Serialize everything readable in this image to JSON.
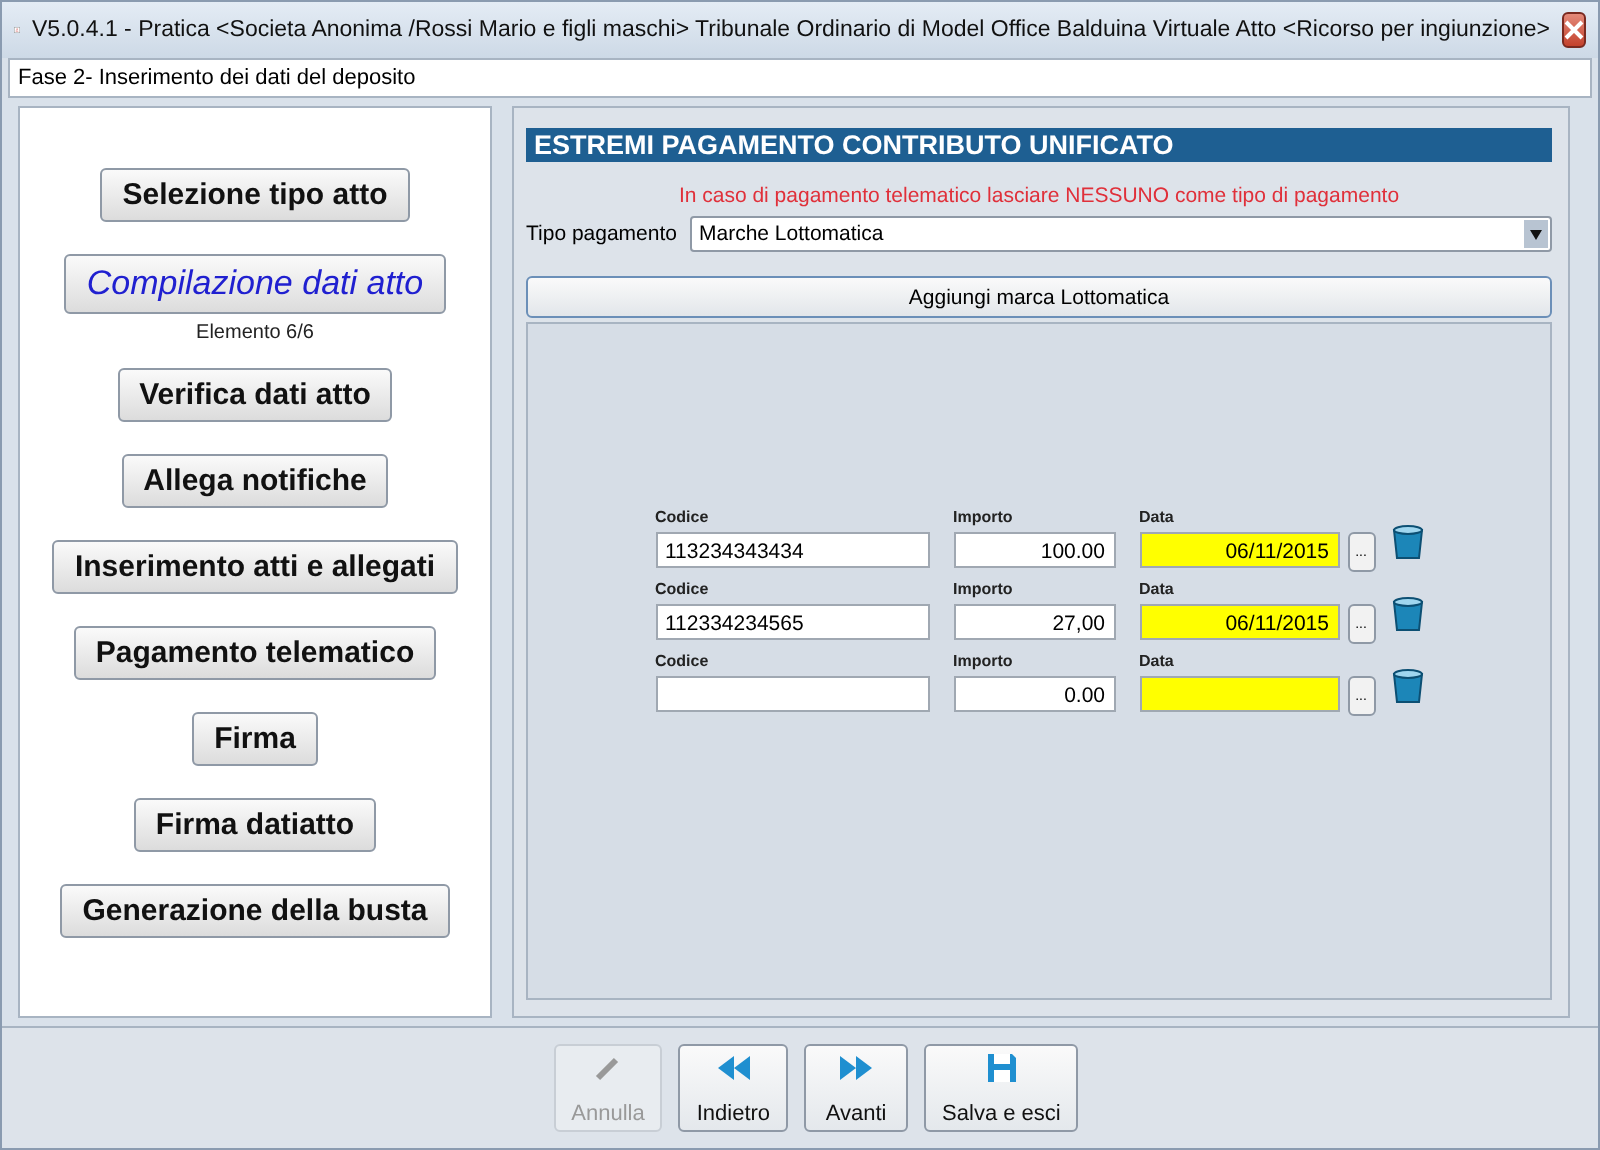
{
  "window": {
    "title": "V5.0.4.1 - Pratica <Societa Anonima /Rossi Mario e figli maschi>   Tribunale Ordinario di Model Office Balduina Virtuale   Atto <Ricorso per ingiunzione>"
  },
  "phase": {
    "value": "Fase 2- Inserimento dei dati del deposito"
  },
  "steps": [
    {
      "label": "Selezione tipo atto",
      "selected": false
    },
    {
      "label": "Compilazione dati atto",
      "selected": true,
      "note": "Elemento 6/6"
    },
    {
      "label": "Verifica dati atto",
      "selected": false
    },
    {
      "label": "Allega notifiche",
      "selected": false
    },
    {
      "label": "Inserimento atti e allegati",
      "selected": false
    },
    {
      "label": "Pagamento telematico",
      "selected": false
    },
    {
      "label": "Firma",
      "selected": false
    },
    {
      "label": "Firma datiatto",
      "selected": false
    },
    {
      "label": "Generazione della busta",
      "selected": false
    }
  ],
  "section": {
    "title": "ESTREMI PAGAMENTO CONTRIBUTO UNIFICATO",
    "warning": "In caso di pagamento telematico lasciare NESSUNO come tipo di pagamento",
    "type_label": "Tipo pagamento",
    "type_value": "Marche Lottomatica",
    "add_button": "Aggiungi marca Lottomatica"
  },
  "entries": [
    {
      "code_label": "Codice",
      "code": "113234343434",
      "amount_label": "Importo",
      "amount": "100.00",
      "date_label": "Data",
      "date": "06/11/2015",
      "picker": "..."
    },
    {
      "code_label": "Codice",
      "code": "112334234565",
      "amount_label": "Importo",
      "amount": "27,00",
      "date_label": "Data",
      "date": "06/11/2015",
      "picker": "..."
    },
    {
      "code_label": "Codice",
      "amount_label": "Importo",
      "amount": "0.00",
      "date_label": "Data",
      "picker": "..."
    }
  ],
  "footer": [
    {
      "kind": "cancel",
      "label": "Annulla",
      "disabled": true
    },
    {
      "kind": "back",
      "label": "Indietro",
      "disabled": false
    },
    {
      "kind": "forward",
      "label": "Avanti",
      "disabled": false
    },
    {
      "kind": "save",
      "label": "Salva e esci",
      "disabled": false
    }
  ]
}
